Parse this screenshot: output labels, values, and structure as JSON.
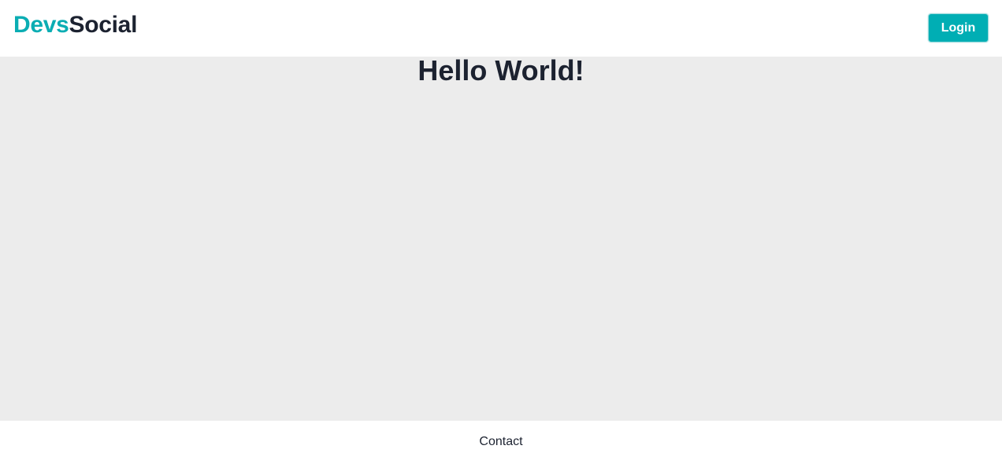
{
  "header": {
    "brand": {
      "accent_text": "Devs",
      "rest_text": "Social"
    },
    "login_label": "Login"
  },
  "main": {
    "title": "Hello World!"
  },
  "footer": {
    "contact_label": "Contact"
  },
  "colors": {
    "accent": "#00aeb4",
    "text": "#1c2230",
    "main_background": "#ececec",
    "header_background": "#ffffff"
  }
}
